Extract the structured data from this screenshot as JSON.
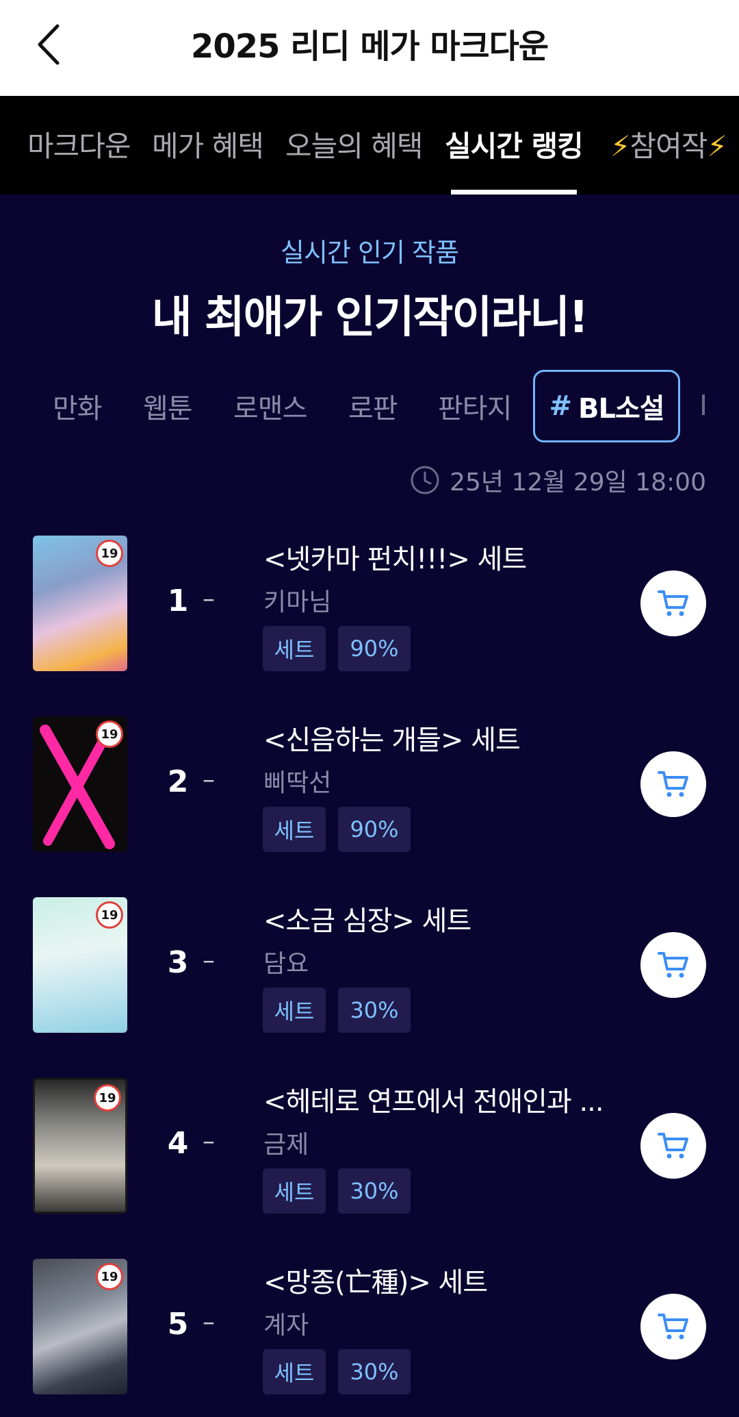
{
  "header": {
    "title": "2025 리디 메가 마크다운"
  },
  "tabs": [
    {
      "label": "마크다운"
    },
    {
      "label": "메가 혜택"
    },
    {
      "label": "오늘의 혜택"
    },
    {
      "label": "실시간 랭킹"
    },
    {
      "label": "참여작"
    }
  ],
  "active_tab": "실시간 랭킹",
  "section": {
    "subtitle": "실시간 인기 작품",
    "title": "내 최애가 인기작이라니!"
  },
  "categories": [
    {
      "label": "만화"
    },
    {
      "label": "웹툰"
    },
    {
      "label": "로맨스"
    },
    {
      "label": "로판"
    },
    {
      "label": "판타지"
    },
    {
      "label": "BL소설"
    }
  ],
  "active_category_hash": "#",
  "timestamp": "25년 12월 29일 18:00",
  "colors": {
    "accent": "#7fc0ff",
    "background": "#0a0530",
    "tag_bg": "#211c4d"
  },
  "ranking": [
    {
      "rank": "1",
      "change": "–",
      "title": "<넷카마 펀치!!!> 세트",
      "author": "키마님",
      "tag": "세트",
      "discount": "90%",
      "badge": "19"
    },
    {
      "rank": "2",
      "change": "–",
      "title": "<신음하는 개들> 세트",
      "author": "삐딱선",
      "tag": "세트",
      "discount": "90%",
      "badge": "19"
    },
    {
      "rank": "3",
      "change": "–",
      "title": "<소금 심장> 세트",
      "author": "담요",
      "tag": "세트",
      "discount": "30%",
      "badge": "19"
    },
    {
      "rank": "4",
      "change": "–",
      "title": "<헤테로 연프에서 전애인과 ...",
      "author": "금제",
      "tag": "세트",
      "discount": "30%",
      "badge": "19"
    },
    {
      "rank": "5",
      "change": "–",
      "title": "<망종(亡種)> 세트",
      "author": "계자",
      "tag": "세트",
      "discount": "30%",
      "badge": "19"
    }
  ]
}
